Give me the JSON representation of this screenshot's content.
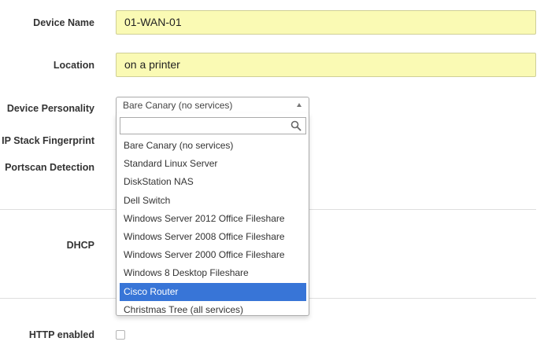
{
  "form": {
    "device_name": {
      "label": "Device Name",
      "value": "01-WAN-01"
    },
    "location": {
      "label": "Location",
      "value": "on a printer"
    },
    "device_personality": {
      "label": "Device Personality",
      "selected": "Bare Canary (no services)",
      "search_value": "",
      "options": [
        "Bare Canary (no services)",
        "Standard Linux Server",
        "DiskStation NAS",
        "Dell Switch",
        "Windows Server 2012 Office Fileshare",
        "Windows Server 2008 Office Fileshare",
        "Windows Server 2000 Office Fileshare",
        "Windows 8 Desktop Fileshare",
        "Cisco Router",
        "Christmas Tree (all services)"
      ],
      "highlighted_index": 8
    },
    "ip_stack_fingerprint": {
      "label": "IP Stack Fingerprint"
    },
    "portscan_detection": {
      "label": "Portscan Detection"
    },
    "dhcp": {
      "label": "DHCP"
    },
    "http_enabled": {
      "label": "HTTP enabled",
      "checked": false
    }
  },
  "colors": {
    "input_bg": "#fafab4",
    "highlight": "#3875d7",
    "divider": "#dedede"
  }
}
